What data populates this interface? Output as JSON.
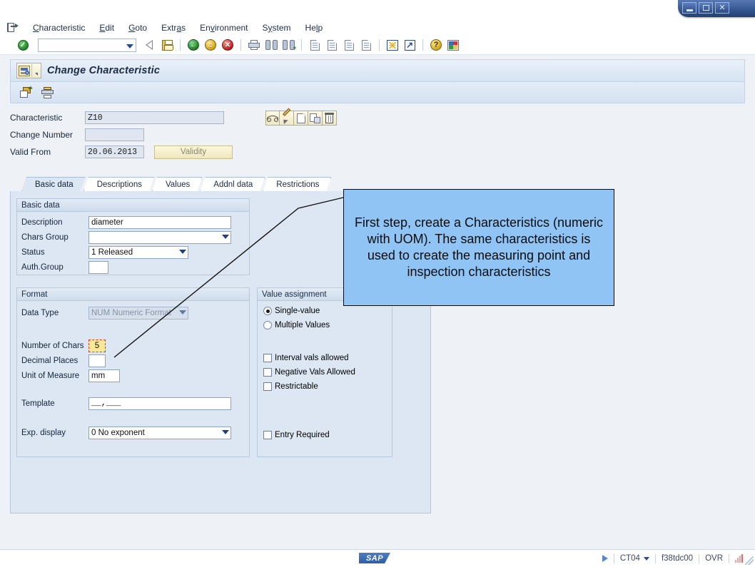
{
  "window": {
    "minimize_label": "Minimize",
    "maximize_label": "Maximize",
    "close_label": "✕"
  },
  "menubar": {
    "items": [
      {
        "label": "Characteristic",
        "accel": "C"
      },
      {
        "label": "Edit",
        "accel": "E"
      },
      {
        "label": "Goto",
        "accel": "G"
      },
      {
        "label": "Extras",
        "accel": "a"
      },
      {
        "label": "Environment",
        "accel": "v"
      },
      {
        "label": "System",
        "accel": "y"
      },
      {
        "label": "Help",
        "accel": "l"
      }
    ]
  },
  "command_field": {
    "value": "",
    "placeholder": ""
  },
  "system_toolbar": {
    "icons": [
      "enter-check-icon",
      "back-arrow-icon",
      "save-icon",
      "exit-icon",
      "home-icon",
      "cancel-icon",
      "print-icon",
      "find-icon",
      "find-next-icon",
      "first-page-icon",
      "previous-page-icon",
      "next-page-icon",
      "last-page-icon",
      "create-session-icon",
      "shortcut-icon",
      "help-icon",
      "customize-local-layout-icon"
    ]
  },
  "transaction": {
    "title": "Change Characteristic",
    "object_icon": "characteristic-object-icon"
  },
  "app_toolbar": {
    "buttons": [
      {
        "name": "create-new-icon",
        "label": "Create"
      },
      {
        "name": "print-icon",
        "label": "Print"
      }
    ]
  },
  "header_form": {
    "characteristic": {
      "label": "Characteristic",
      "value": "Z10"
    },
    "change_number": {
      "label": "Change Number",
      "value": ""
    },
    "valid_from": {
      "label": "Valid From",
      "value": "20.06.2013"
    },
    "validity_button": "Validity",
    "object_buttons": [
      {
        "name": "display-glasses-icon",
        "label": "Display"
      },
      {
        "name": "edit-pencil-icon",
        "label": "Change"
      },
      {
        "name": "create-blank-page-icon",
        "label": "Create"
      },
      {
        "name": "copy-icon",
        "label": "Create with reference"
      },
      {
        "name": "delete-trash-icon",
        "label": "Delete"
      }
    ]
  },
  "tabs": [
    {
      "label": "Basic data",
      "active": true
    },
    {
      "label": "Descriptions",
      "active": false
    },
    {
      "label": "Values",
      "active": false
    },
    {
      "label": "Addnl data",
      "active": false
    },
    {
      "label": "Restrictions",
      "active": false
    }
  ],
  "basic_data": {
    "title": "Basic data",
    "description": {
      "label": "Description",
      "value": "diameter"
    },
    "chars_group": {
      "label": "Chars Group",
      "value": ""
    },
    "status": {
      "label": "Status",
      "value": "1 Released"
    },
    "auth_group": {
      "label": "Auth.Group",
      "value": ""
    }
  },
  "format": {
    "title": "Format",
    "data_type": {
      "label": "Data Type",
      "value": "NUM Numeric Format"
    },
    "number_of_chars": {
      "label": "Number of Chars",
      "value": "5"
    },
    "decimal_places": {
      "label": "Decimal Places",
      "value": ""
    },
    "unit_of_measure": {
      "label": "Unit of Measure",
      "value": "mm"
    },
    "template": {
      "label": "Template",
      "value": "__,___"
    },
    "exp_display": {
      "label": "Exp. display",
      "value": "0 No exponent"
    }
  },
  "value_assignment": {
    "title": "Value assignment",
    "radios": [
      {
        "label": "Single-value",
        "selected": true
      },
      {
        "label": "Multiple Values",
        "selected": false
      }
    ],
    "checkboxes": [
      {
        "label": "Interval vals allowed",
        "checked": false
      },
      {
        "label": "Negative Vals Allowed",
        "checked": false
      },
      {
        "label": "Restrictable",
        "checked": false
      }
    ],
    "entry_required": {
      "label": "Entry Required",
      "checked": false
    }
  },
  "callout": {
    "text": "First step, create a Characteristics (numeric with UOM). The same characteristics is used to create the measuring point and inspection characteristics",
    "background_color": "#8fc4f5",
    "border_color": "#0b0b0b"
  },
  "statusbar": {
    "logo": "SAP",
    "transaction_code": "CT04",
    "system_host": "f38tdc00",
    "insert_mode": "OVR"
  }
}
